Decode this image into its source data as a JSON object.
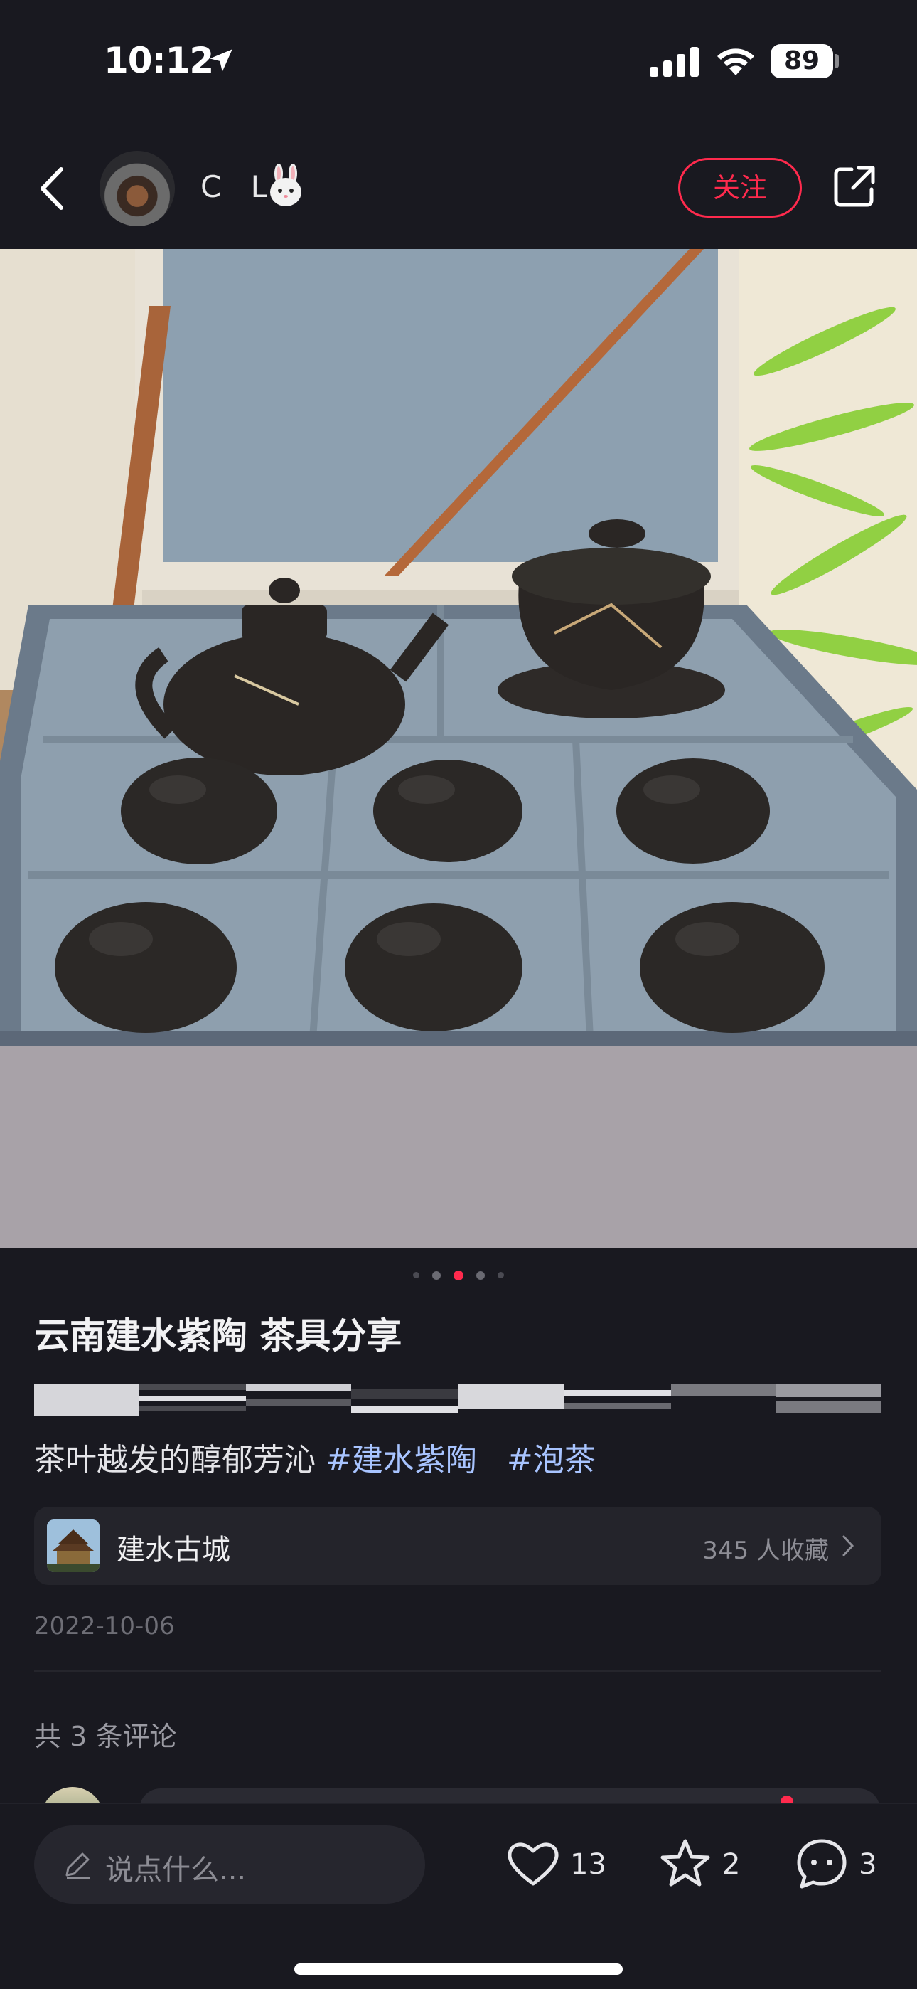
{
  "status_bar": {
    "time": "10:12",
    "battery": "89"
  },
  "header": {
    "username": "C L",
    "follow_label": "关注"
  },
  "carousel": {
    "total": 5,
    "active_index": 2
  },
  "post": {
    "title": "云南建水紫陶  茶具分享",
    "body_text": "茶叶越发的醇郁芳沁 ",
    "tags": [
      "#建水紫陶",
      "#泡茶"
    ],
    "location": {
      "name": "建水古城",
      "saved_count": "345 人收藏"
    },
    "date": "2022-10-06"
  },
  "comments": {
    "header": "共 3 条评论"
  },
  "bottom_bar": {
    "input_placeholder": "说点什么...",
    "likes": "13",
    "collects": "2",
    "comments": "3"
  },
  "colors": {
    "background": "#191920",
    "accent": "#ff2a4d",
    "tag": "#a8c4ff"
  }
}
